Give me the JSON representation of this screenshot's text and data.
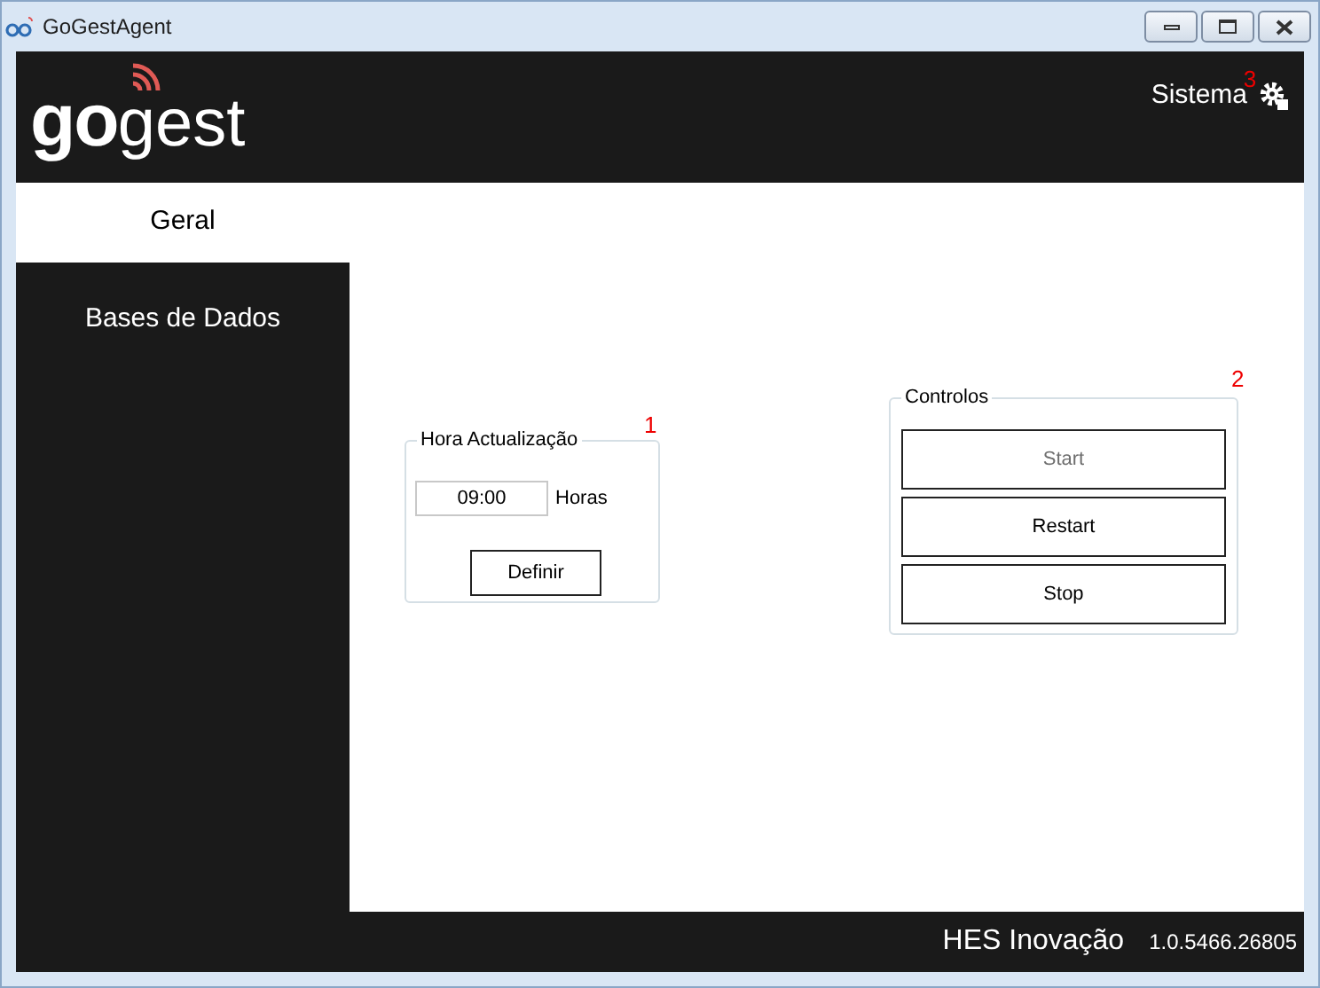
{
  "window": {
    "title": "GoGestAgent"
  },
  "header": {
    "logo": {
      "bold": "go",
      "light": "gest"
    },
    "menu": {
      "label": "Sistema",
      "marker": "3"
    }
  },
  "sidebar": {
    "items": [
      {
        "label": "Geral",
        "selected": true
      },
      {
        "label": "Bases de Dados",
        "selected": false
      }
    ]
  },
  "update_group": {
    "title": "Hora Actualização",
    "marker": "1",
    "time": "09:00",
    "unit": "Horas",
    "button": "Definir"
  },
  "controls_group": {
    "title": "Controlos",
    "marker": "2",
    "buttons": [
      {
        "label": "Start",
        "disabled": true
      },
      {
        "label": "Restart",
        "disabled": false
      },
      {
        "label": "Stop",
        "disabled": false
      }
    ]
  },
  "footer": {
    "company": "HES Inovação",
    "version": "1.0.5466.26805"
  }
}
